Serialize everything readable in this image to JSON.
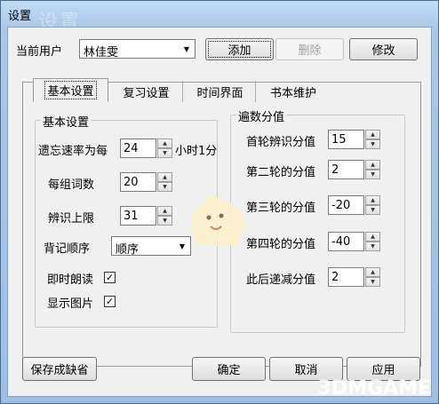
{
  "window": {
    "title": "设置",
    "title_ghost": "设置"
  },
  "user": {
    "label": "当前用户",
    "selected": "林佳雯",
    "add": "添加",
    "delete": "删除",
    "modify": "修改"
  },
  "tabs": [
    "基本设置",
    "复习设置",
    "时间界面",
    "书本维护"
  ],
  "basic_group": {
    "title": "基本设置",
    "forget_rate_label": "遗忘速率为每",
    "forget_rate_value": "24",
    "forget_rate_unit": "小时1分",
    "words_per_group_label": "每组词数",
    "words_per_group_value": "20",
    "recognize_limit_label": "辨识上限",
    "recognize_limit_value": "31",
    "recite_order_label": "背记顺序",
    "recite_order_value": "顺序",
    "instant_read_label": "即时朗读",
    "instant_read_checked": "✓",
    "show_image_label": "显示图片",
    "show_image_checked": "✓"
  },
  "score_group": {
    "title": "遍数分值",
    "first_label": "首轮辨识分值",
    "first_value": "15",
    "second_label": "第二轮的分值",
    "second_value": "2",
    "third_label": "第三轮的分值",
    "third_value": "-20",
    "fourth_label": "第四轮的分值",
    "fourth_value": "-40",
    "later_label": "此后递减分值",
    "later_value": "2"
  },
  "footer": {
    "save_default": "保存成缺省",
    "ok": "确定",
    "cancel": "取消",
    "apply": "应用"
  },
  "watermark": "3DMGAME",
  "icons": {
    "spin_up": "▲",
    "spin_down": "▼",
    "dropdown": "▼"
  }
}
